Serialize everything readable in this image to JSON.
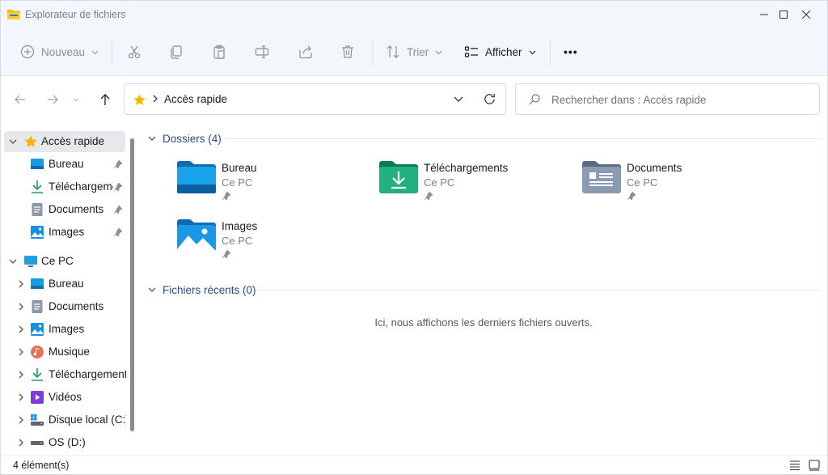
{
  "window": {
    "title": "Explorateur de fichiers"
  },
  "toolbar": {
    "new_label": "Nouveau",
    "sort_label": "Trier",
    "view_label": "Afficher",
    "more_label": "•••"
  },
  "address": {
    "crumb": "Accès rapide"
  },
  "search": {
    "placeholder": "Rechercher dans : Accès rapide"
  },
  "sidebar": {
    "items": [
      {
        "label": "Accès rapide",
        "icon": "star-icon",
        "selected": true
      },
      {
        "label": "Bureau",
        "icon": "desktop-icon",
        "pinned": true
      },
      {
        "label": "Téléchargements",
        "icon": "download-icon",
        "pinned": true
      },
      {
        "label": "Documents",
        "icon": "documents-icon",
        "pinned": true
      },
      {
        "label": "Images",
        "icon": "pictures-icon",
        "pinned": true
      },
      {
        "label": "Ce PC",
        "icon": "monitor-icon"
      },
      {
        "label": "Bureau",
        "icon": "desktop-icon"
      },
      {
        "label": "Documents",
        "icon": "documents-icon"
      },
      {
        "label": "Images",
        "icon": "pictures-icon"
      },
      {
        "label": "Musique",
        "icon": "music-icon"
      },
      {
        "label": "Téléchargements",
        "icon": "download-icon"
      },
      {
        "label": "Vidéos",
        "icon": "videos-icon"
      },
      {
        "label": "Disque local (C:)",
        "icon": "drive-c-icon"
      },
      {
        "label": "OS (D:)",
        "icon": "drive-d-icon"
      }
    ]
  },
  "main": {
    "folders_header": "Dossiers (4)",
    "recent_header": "Fichiers récents (0)",
    "empty_message": "Ici, nous affichons les derniers fichiers ouverts.",
    "folders": [
      {
        "name": "Bureau",
        "location": "Ce PC",
        "icon": "desktop-folder-icon"
      },
      {
        "name": "Téléchargements",
        "location": "Ce PC",
        "icon": "downloads-folder-icon"
      },
      {
        "name": "Documents",
        "location": "Ce PC",
        "icon": "documents-folder-icon"
      },
      {
        "name": "Images",
        "location": "Ce PC",
        "icon": "pictures-folder-icon"
      }
    ]
  },
  "status": {
    "count": "4 élément(s)"
  },
  "colors": {
    "accent": "#2c4a86",
    "selection": "#e6e8ec",
    "folder_blue": "#1e90d6"
  }
}
